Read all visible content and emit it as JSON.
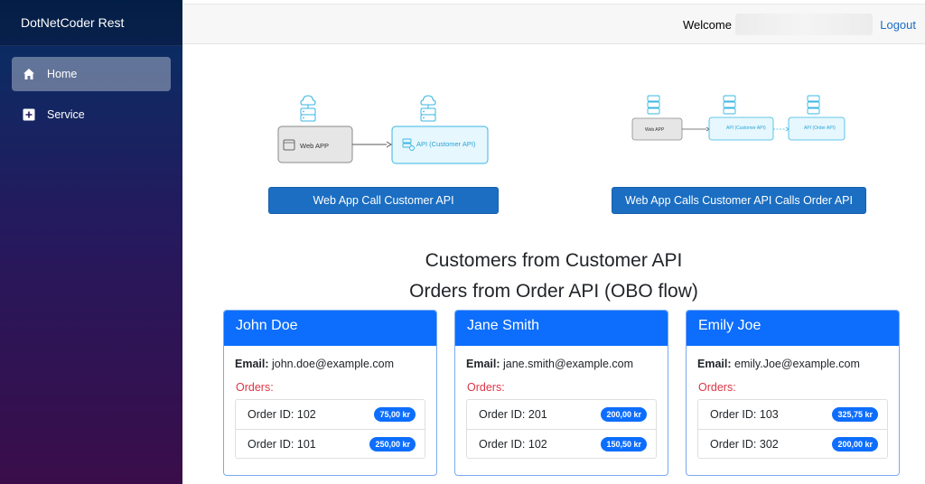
{
  "sidebar": {
    "brand": "DotNetCoder Rest",
    "items": [
      {
        "label": "Home",
        "icon": "home-icon",
        "active": true
      },
      {
        "label": "Service",
        "icon": "plus-square-icon",
        "active": false
      }
    ]
  },
  "topbar": {
    "welcome": "Welcome",
    "logout": "Logout"
  },
  "diagrams": {
    "left": {
      "node1": "Web APP",
      "node2": "API (Customer API)"
    },
    "right": {
      "node1": "Web APP",
      "node2": "API (Customer API)",
      "node3": "API (Order API)"
    }
  },
  "buttons": {
    "left": "Web App Call Customer API",
    "right": "Web App Calls Customer API Calls Order API"
  },
  "headings": {
    "customers": "Customers from Customer API",
    "orders": "Orders from Order API (OBO flow)"
  },
  "labels": {
    "email": "Email:",
    "orders": "Orders:"
  },
  "customers": [
    {
      "name": "John Doe",
      "email": "john.doe@example.com",
      "orders": [
        {
          "id": "Order ID: 102",
          "amount": "75,00 kr"
        },
        {
          "id": "Order ID: 101",
          "amount": "250,00 kr"
        }
      ]
    },
    {
      "name": "Jane Smith",
      "email": "jane.smith@example.com",
      "orders": [
        {
          "id": "Order ID: 201",
          "amount": "200,00 kr"
        },
        {
          "id": "Order ID: 102",
          "amount": "150,50 kr"
        }
      ]
    },
    {
      "name": "Emily Joe",
      "email": "emily.Joe@example.com",
      "orders": [
        {
          "id": "Order ID: 103",
          "amount": "325,75 kr"
        },
        {
          "id": "Order ID: 302",
          "amount": "200,00 kr"
        }
      ]
    }
  ],
  "colors": {
    "primary": "#0d6efd",
    "button": "#1b6ec2",
    "danger": "#dc3545",
    "api_node": "#e6f7fd",
    "api_stroke": "#39b6e3"
  }
}
